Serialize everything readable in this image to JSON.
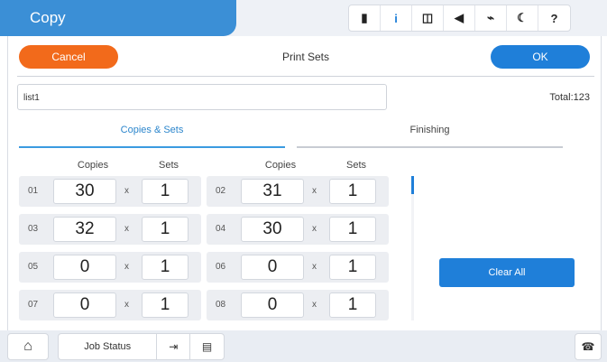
{
  "header": {
    "title": "Copy",
    "status_icons": [
      {
        "name": "ink-icon",
        "glyph": "▮"
      },
      {
        "name": "info-icon",
        "glyph": "i"
      },
      {
        "name": "wifi-icon",
        "glyph": "◫"
      },
      {
        "name": "sound-icon",
        "glyph": "◀"
      },
      {
        "name": "wifi-direct-off-icon",
        "glyph": "⌁"
      },
      {
        "name": "sleep-icon",
        "glyph": "☾"
      },
      {
        "name": "help-icon",
        "glyph": "?"
      }
    ]
  },
  "dialog": {
    "cancel_label": "Cancel",
    "title": "Print Sets",
    "ok_label": "OK"
  },
  "list": {
    "name": "list1",
    "total": "Total:123"
  },
  "tabs": {
    "copies_sets": "Copies & Sets",
    "finishing": "Finishing"
  },
  "columns": {
    "copies": "Copies",
    "sets": "Sets",
    "times": "x"
  },
  "rows": [
    {
      "num": "01",
      "copies": "30",
      "sets": "1"
    },
    {
      "num": "02",
      "copies": "31",
      "sets": "1"
    },
    {
      "num": "03",
      "copies": "32",
      "sets": "1"
    },
    {
      "num": "04",
      "copies": "30",
      "sets": "1"
    },
    {
      "num": "05",
      "copies": "0",
      "sets": "1"
    },
    {
      "num": "06",
      "copies": "0",
      "sets": "1"
    },
    {
      "num": "07",
      "copies": "0",
      "sets": "1"
    },
    {
      "num": "08",
      "copies": "0",
      "sets": "1"
    }
  ],
  "clear_all_label": "Clear All",
  "footer": {
    "home_icon": "home-icon",
    "job_status_label": "Job Status",
    "icons": [
      "stop-icon",
      "print-queue-icon",
      "fax-icon"
    ]
  },
  "colors": {
    "accent": "#1f7fd9",
    "cancel": "#f26a1b",
    "title_bar": "#3b8fd6"
  }
}
